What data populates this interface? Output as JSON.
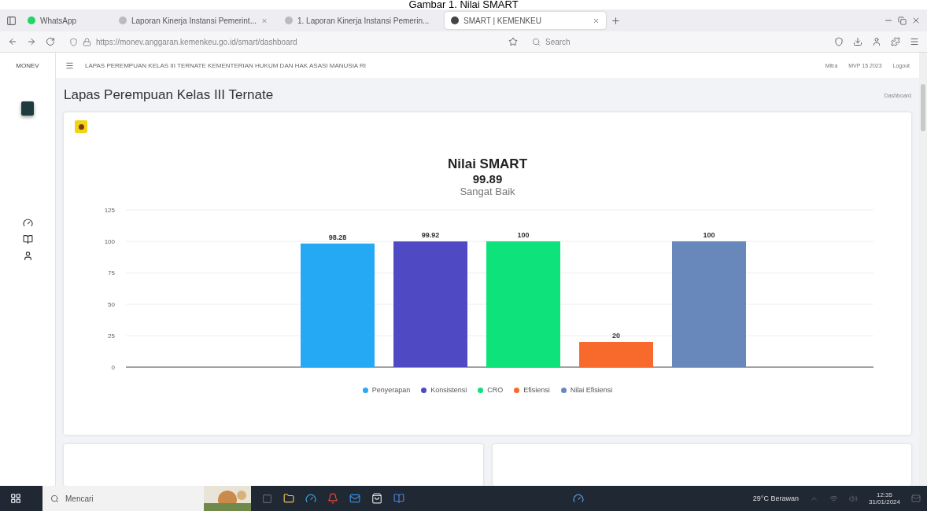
{
  "caption": "Gambar 1. Nilai SMART",
  "browser": {
    "tabs": [
      {
        "title": "WhatsApp",
        "kind": "pinned",
        "selected": false
      },
      {
        "title": "Laporan Kinerja Instansi Pemerint...",
        "kind": "normal",
        "selected": false
      },
      {
        "title": "1. Laporan Kinerja Instansi Pemerin...",
        "kind": "normal",
        "selected": false
      },
      {
        "title": "SMART | KEMENKEU",
        "kind": "normal",
        "selected": true
      }
    ],
    "url": "https://monev.anggaran.kemenkeu.go.id/smart/dashboard",
    "search_placeholder": "Search"
  },
  "app": {
    "brand": "MONEV",
    "header_title": "LAPAS PEREMPUAN KELAS III TERNATE KEMENTERIAN HUKUM DAN HAK ASASI MANUSIA RI",
    "header_links": [
      "Mitra",
      "MVP 15 2023",
      "Logout"
    ],
    "page_title": "Lapas Perempuan Kelas III Ternate",
    "breadcrumb": "Dashboard",
    "score": "99.89",
    "rating": "Sangat Baik",
    "chart_data": {
      "type": "bar",
      "title": "Nilai SMART",
      "ylim": [
        0,
        125
      ],
      "yticks": [
        0,
        25,
        50,
        75,
        100,
        125
      ],
      "grid": true,
      "value_labels": [
        "98.28",
        "99.92",
        "100",
        "20",
        "100"
      ],
      "series": [
        {
          "name": "Penyerapan",
          "color": "#26a9f5",
          "values": [
            98.28
          ]
        },
        {
          "name": "Konsistensi",
          "color": "#5049c4",
          "values": [
            99.92
          ]
        },
        {
          "name": "CRO",
          "color": "#0de37a",
          "values": [
            100
          ]
        },
        {
          "name": "Efisiensi",
          "color": "#f86a2c",
          "values": [
            20
          ]
        },
        {
          "name": "Nilai Efisiensi",
          "color": "#6888bb",
          "values": [
            100
          ]
        }
      ]
    }
  },
  "taskbar": {
    "search_placeholder": "Mencari",
    "weather": "29°C Berawan",
    "time": "12:35",
    "date": "31/01/2024"
  }
}
